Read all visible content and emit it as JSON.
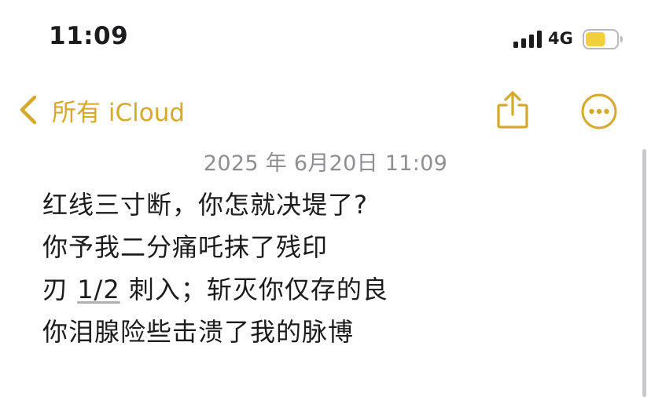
{
  "status_bar": {
    "time": "11:09",
    "network": "4G",
    "signal_bars": 4,
    "battery_level": 0.65,
    "battery_color": "#f4cf3c"
  },
  "nav": {
    "back_label": "所有 iCloud",
    "back_icon": "chevron-left-icon",
    "share_icon": "share-icon",
    "more_icon": "ellipsis-circle-icon",
    "accent_color": "#d7a92b"
  },
  "note": {
    "date": "2025 年 6月20日 11:09",
    "lines": [
      "红线三寸断，你怎就决堤了?",
      "你予我二分痛吒抹了残印"
    ],
    "line3_prefix": "刃 ",
    "line3_fraction": "1/2",
    "line3_suffix": " 刺入；斩灭你仅存的良",
    "line4": "你泪腺险些击溃了我的脉博"
  }
}
